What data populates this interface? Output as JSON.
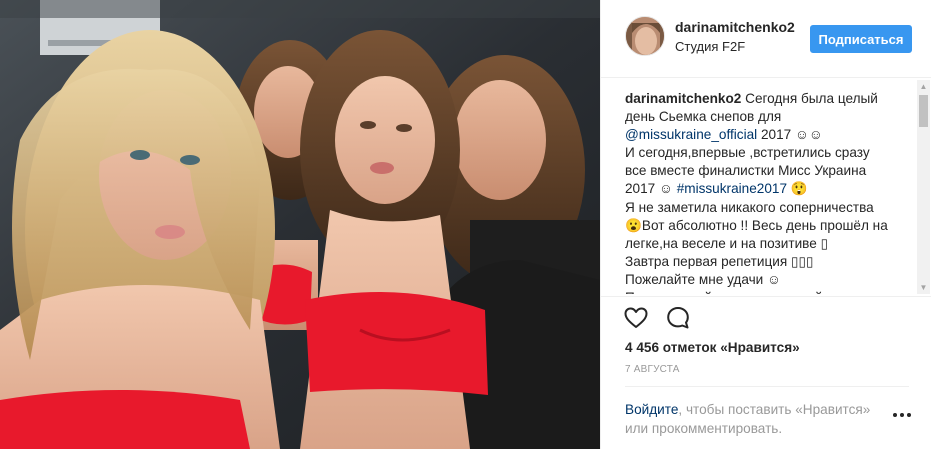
{
  "post": {
    "author": {
      "username": "darinamitchenko2",
      "location": "Студия F2F"
    },
    "follow_label": "Подписаться",
    "caption": {
      "username": "darinamitchenko2",
      "lines": [
        {
          "parts": [
            {
              "text": "Сегодня была целый"
            }
          ]
        },
        {
          "parts": [
            {
              "text": "день Сьемка снепов для"
            }
          ]
        },
        {
          "parts": [
            {
              "text": "@missukraine_official",
              "tag": true
            },
            {
              "text": " 2017 ☺☺"
            }
          ]
        },
        {
          "parts": [
            {
              "text": "И сегодня,впервые ,встретились сразу"
            }
          ]
        },
        {
          "parts": [
            {
              "text": "все вместе финалистки Мисс Украина"
            }
          ]
        },
        {
          "parts": [
            {
              "text": "2017 ☺ "
            },
            {
              "text": "#missukraine2017",
              "tag": true
            },
            {
              "text": " 😲"
            }
          ]
        },
        {
          "parts": [
            {
              "text": "Я не заметила никакого соперничества"
            }
          ]
        },
        {
          "parts": [
            {
              "text": "😮Вот абсолютно !! Весь день прошёл на"
            }
          ]
        },
        {
          "parts": [
            {
              "text": "легке,на веселе и на позитиве ▯"
            }
          ]
        },
        {
          "parts": [
            {
              "text": "Завтра первая репетиция ▯▯▯"
            }
          ]
        },
        {
          "parts": [
            {
              "text": "Пожелайте мне удачи ☺"
            }
          ]
        },
        {
          "parts": [
            {
              "text": "Поддерживайте меня, пожалуйста"
            }
          ]
        }
      ]
    },
    "actions": {
      "like_icon": "heart-icon",
      "comment_icon": "comment-bubble-icon"
    },
    "likes_text": "4 456 отметок «Нравится»",
    "date_text": "7 АВГУСТА",
    "comment_prompt": {
      "login_link": "Войдите",
      "rest": ", чтобы поставить «Нравится» или прокомментировать."
    },
    "more_icon": "ellipsis-icon",
    "colors": {
      "accent": "#3897f0",
      "link": "#003569",
      "muted": "#999999",
      "text": "#262626",
      "swimsuit": "#e8192c"
    }
  }
}
